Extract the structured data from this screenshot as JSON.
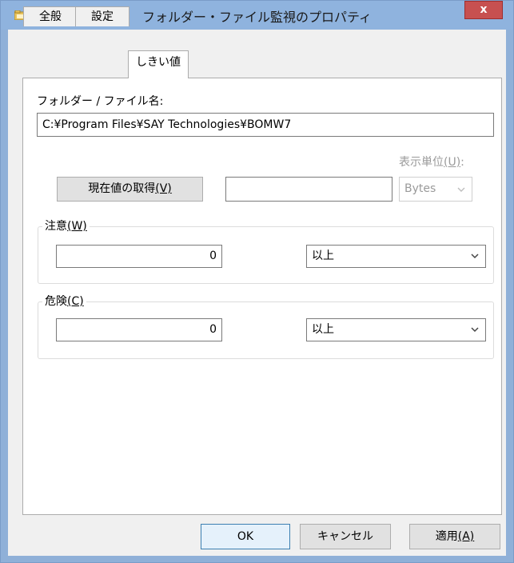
{
  "window": {
    "title": "フォルダー・ファイル監視のプロパティ",
    "close_label": "x"
  },
  "tabs": [
    {
      "label": "全般"
    },
    {
      "label": "設定"
    },
    {
      "label": "しきい値"
    }
  ],
  "path": {
    "label": "フォルダー / ファイル名:",
    "value": "C:¥Program Files¥SAY Technologies¥BOMW7"
  },
  "current_value": {
    "button_label": "現在値の取得",
    "button_mnemonic": "(V)",
    "value": ""
  },
  "unit": {
    "label": "表示単位",
    "mnemonic": "(U)",
    "suffix": ":",
    "selected": "Bytes"
  },
  "warning": {
    "title": "注意",
    "mnemonic": "(W)",
    "value": "0",
    "condition": "以上"
  },
  "danger": {
    "title": "危険",
    "mnemonic": "(C)",
    "value": "0",
    "condition": "以上"
  },
  "footer": {
    "ok_label": "OK",
    "cancel_label": "キャンセル",
    "apply_label": "適用",
    "apply_mnemonic": "(A)"
  },
  "colors": {
    "titlebar": "#8fb3de",
    "close": "#c75050",
    "dialog_bg": "#f0f0f0"
  }
}
